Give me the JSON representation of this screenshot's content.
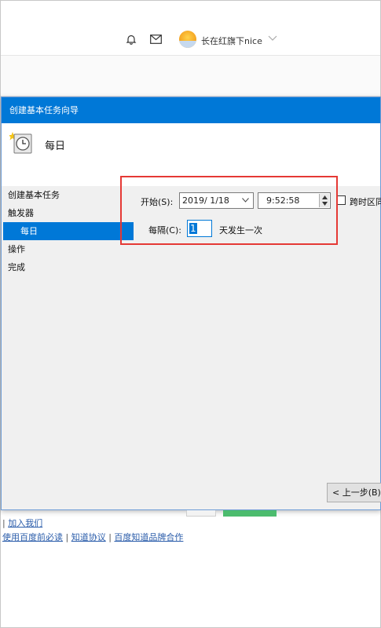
{
  "header": {
    "icons": [
      "bell-icon",
      "mail-icon",
      "chevron-down-icon"
    ],
    "username": "长在红旗下nice"
  },
  "dialog": {
    "title": "创建基本任务向导",
    "header_title": "每日",
    "steps": [
      "创建基本任务",
      "触发器",
      "每日",
      "操作",
      "完成"
    ],
    "start_label": "开始(S):",
    "start_date": "2019/  1/18",
    "start_time": "9:52:58",
    "timezone_label": "跨时区同",
    "recur_label": "每隔(C):",
    "recur_value": "1",
    "recur_suffix": "天发生一次",
    "back_button": "< 上一步(B)"
  },
  "footer": {
    "links_line1": [
      "加入我们"
    ],
    "links_line2": [
      "使用百度前必读",
      "知道协议",
      "百度知道品牌合作"
    ]
  },
  "colors": {
    "titlebar": "#0078d7",
    "highlight": "#e53935",
    "link": "#2a5caa",
    "green_button": "#4cbc6e"
  }
}
